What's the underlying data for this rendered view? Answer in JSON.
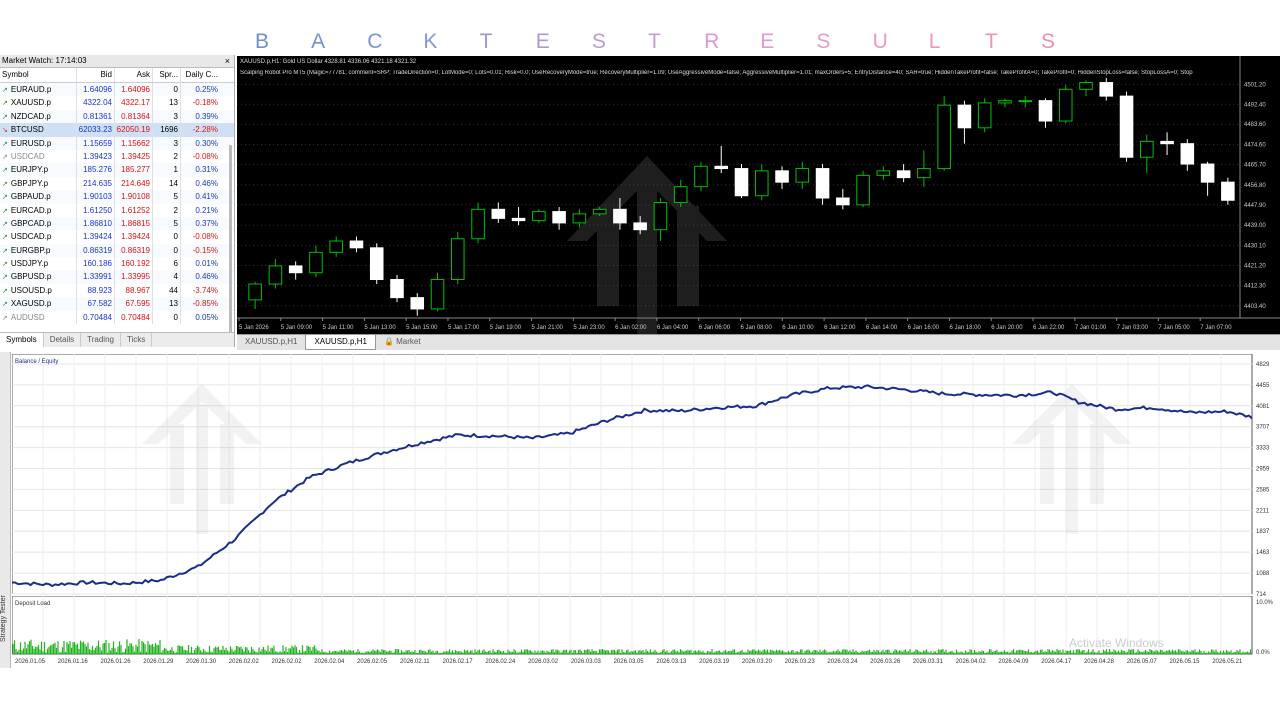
{
  "header": {
    "letters": [
      "B",
      "A",
      "C",
      "K",
      "T",
      "E",
      "S",
      "T",
      "R",
      "E",
      "S",
      "U",
      "L",
      "T",
      "S"
    ],
    "letter_colors": [
      "#6f8fd0",
      "#7491d1",
      "#7d93d2",
      "#8b96d4",
      "#9a98d5",
      "#ab9ad6",
      "#bb9ad6",
      "#cc9ad6",
      "#d99ad4",
      "#e29ad0",
      "#e79acb",
      "#ea98c4",
      "#ec96bd",
      "#ed93b5",
      "#ee90ad"
    ]
  },
  "market_watch": {
    "title": "Market Watch: 17:14:03",
    "close": "×",
    "columns": [
      "Symbol",
      "Bid",
      "Ask",
      "Spr...",
      "Daily C..."
    ],
    "rows": [
      {
        "symbol": "EURAUD.p",
        "bid": "1.64096",
        "ask": "1.64096",
        "spread": "0",
        "change": "0.25%",
        "dir": "up"
      },
      {
        "symbol": "XAUUSD.p",
        "bid": "4322.04",
        "ask": "4322.17",
        "spread": "13",
        "change": "-0.18%",
        "dir": "up"
      },
      {
        "symbol": "NZDCAD.p",
        "bid": "0.81361",
        "ask": "0.81364",
        "spread": "3",
        "change": "0.39%",
        "dir": "up"
      },
      {
        "symbol": "BTCUSD",
        "bid": "62033.23",
        "ask": "62050.19",
        "spread": "1696",
        "change": "-2.28%",
        "dir": "down"
      },
      {
        "symbol": "EURUSD.p",
        "bid": "1.15659",
        "ask": "1.15662",
        "spread": "3",
        "change": "0.30%",
        "dir": "up"
      },
      {
        "symbol": "USDCAD",
        "bid": "1.39423",
        "ask": "1.39425",
        "spread": "2",
        "change": "-0.08%",
        "dir": "flat"
      },
      {
        "symbol": "EURJPY.p",
        "bid": "185.276",
        "ask": "185.277",
        "spread": "1",
        "change": "0.31%",
        "dir": "up"
      },
      {
        "symbol": "GBPJPY.p",
        "bid": "214.635",
        "ask": "214.649",
        "spread": "14",
        "change": "0.46%",
        "dir": "up"
      },
      {
        "symbol": "GBPAUD.p",
        "bid": "1.90103",
        "ask": "1.90108",
        "spread": "5",
        "change": "0.41%",
        "dir": "up"
      },
      {
        "symbol": "EURCAD.p",
        "bid": "1.61250",
        "ask": "1.61252",
        "spread": "2",
        "change": "0.21%",
        "dir": "up"
      },
      {
        "symbol": "GBPCAD.p",
        "bid": "1.86810",
        "ask": "1.86815",
        "spread": "5",
        "change": "0.37%",
        "dir": "up"
      },
      {
        "symbol": "USDCAD.p",
        "bid": "1.39424",
        "ask": "1.39424",
        "spread": "0",
        "change": "-0.08%",
        "dir": "up"
      },
      {
        "symbol": "EURGBP.p",
        "bid": "0.86319",
        "ask": "0.86319",
        "spread": "0",
        "change": "-0.15%",
        "dir": "up"
      },
      {
        "symbol": "USDJPY.p",
        "bid": "160.186",
        "ask": "160.192",
        "spread": "6",
        "change": "0.01%",
        "dir": "up"
      },
      {
        "symbol": "GBPUSD.p",
        "bid": "1.33991",
        "ask": "1.33995",
        "spread": "4",
        "change": "0.46%",
        "dir": "up"
      },
      {
        "symbol": "USOUSD.p",
        "bid": "88.923",
        "ask": "88.967",
        "spread": "44",
        "change": "-3.74%",
        "dir": "up"
      },
      {
        "symbol": "XAGUSD.p",
        "bid": "67.582",
        "ask": "67.595",
        "spread": "13",
        "change": "-0.85%",
        "dir": "up"
      },
      {
        "symbol": "AUDUSD",
        "bid": "0.70484",
        "ask": "0.70484",
        "spread": "0",
        "change": "0.05%",
        "dir": "flat"
      }
    ],
    "tabs": [
      "Symbols",
      "Details",
      "Trading",
      "Ticks"
    ]
  },
  "price_chart": {
    "symbol_line": "XAUUSD.p,H1:  Gold US Dollar  4328.81 4336.06 4321.18 4321.32",
    "ea_line": "Scalping Robot Pro MT5 (Magic=77781; comment=SRP; TradeDirection=0; LotMode=0; Lots=0.01; Risk=0.0; UseRecoveryMode=true; RecoveryMultiplier=1.09; UseAggressiveMode=false; AggressiveMultiplier=1.01; maxOrders=5; EntryDistance=40; SAR=true; HiddenTakeProfit=false; TakeProfitA=0; TakeProfit=0; HiddenStopLoss=false; StopLossA=0; Stop",
    "y_ticks": [
      "4501.20",
      "4492.40",
      "4483.60",
      "4474.60",
      "4465.70",
      "4456.80",
      "4447.90",
      "4439.00",
      "4430.10",
      "4421.20",
      "4412.30",
      "4403.40"
    ],
    "x_ticks": [
      "5 Jan 2026",
      "5 Jan 09:00",
      "5 Jan 11:00",
      "5 Jan 13:00",
      "5 Jan 15:00",
      "5 Jan 17:00",
      "5 Jan 19:00",
      "5 Jan 21:00",
      "5 Jan 23:00",
      "6 Jan 02:00",
      "6 Jan 04:00",
      "6 Jan 06:00",
      "6 Jan 08:00",
      "6 Jan 10:00",
      "6 Jan 12:00",
      "6 Jan 14:00",
      "6 Jan 16:00",
      "6 Jan 18:00",
      "6 Jan 20:00",
      "6 Jan 22:00",
      "7 Jan 01:00",
      "7 Jan 03:00",
      "7 Jan 05:00",
      "7 Jan 07:00"
    ],
    "tabs": [
      "XAUUSD.p,H1",
      "XAUUSD.p,H1",
      "Market"
    ],
    "ylim": [
      4398,
      4504
    ],
    "candles": [
      [
        4406,
        4413,
        4402,
        4414
      ],
      [
        4413,
        4421,
        4411,
        4424
      ],
      [
        4421,
        4418,
        4415,
        4423
      ],
      [
        4418,
        4427,
        4416,
        4430
      ],
      [
        4427,
        4432,
        4425,
        4434
      ],
      [
        4432,
        4429,
        4427,
        4434
      ],
      [
        4429,
        4415,
        4413,
        4431
      ],
      [
        4415,
        4407,
        4405,
        4417
      ],
      [
        4407,
        4402,
        4399,
        4409
      ],
      [
        4402,
        4415,
        4401,
        4418
      ],
      [
        4415,
        4433,
        4413,
        4436
      ],
      [
        4433,
        4446,
        4431,
        4449
      ],
      [
        4446,
        4442,
        4440,
        4449
      ],
      [
        4442,
        4441,
        4439,
        4447
      ],
      [
        4441,
        4445,
        4440,
        4446
      ],
      [
        4445,
        4440,
        4437,
        4447
      ],
      [
        4440,
        4444,
        4438,
        4446
      ],
      [
        4444,
        4446,
        4443,
        4447
      ],
      [
        4446,
        4440,
        4437,
        4451
      ],
      [
        4440,
        4437,
        4435,
        4443
      ],
      [
        4437,
        4449,
        4432,
        4451
      ],
      [
        4449,
        4456,
        4447,
        4459
      ],
      [
        4456,
        4465,
        4454,
        4467
      ],
      [
        4465,
        4464,
        4462,
        4474
      ],
      [
        4464,
        4452,
        4451,
        4466
      ],
      [
        4452,
        4463,
        4450,
        4466
      ],
      [
        4463,
        4458,
        4455,
        4465
      ],
      [
        4458,
        4464,
        4455,
        4467
      ],
      [
        4464,
        4451,
        4448,
        4466
      ],
      [
        4451,
        4448,
        4446,
        4455
      ],
      [
        4448,
        4461,
        4447,
        4463
      ],
      [
        4461,
        4463,
        4459,
        4465
      ],
      [
        4463,
        4460,
        4458,
        4466
      ],
      [
        4460,
        4464,
        4456,
        4472
      ],
      [
        4464,
        4492,
        4463,
        4496
      ],
      [
        4492,
        4482,
        4475,
        4494
      ],
      [
        4482,
        4493,
        4480,
        4495
      ],
      [
        4493,
        4494,
        4491,
        4495
      ],
      [
        4494,
        4494,
        4491,
        4496
      ],
      [
        4494,
        4485,
        4482,
        4495
      ],
      [
        4485,
        4499,
        4484,
        4501
      ],
      [
        4499,
        4502,
        4496,
        4503
      ],
      [
        4502,
        4496,
        4494,
        4504
      ],
      [
        4496,
        4469,
        4467,
        4498
      ],
      [
        4469,
        4476,
        4462,
        4479
      ],
      [
        4476,
        4475,
        4470,
        4480
      ],
      [
        4475,
        4466,
        4463,
        4477
      ],
      [
        4466,
        4458,
        4452,
        4467
      ],
      [
        4458,
        4450,
        4448,
        4460
      ]
    ]
  },
  "tester": {
    "side_label": "Strategy Tester",
    "balance_legend": "Balance / Equity",
    "balance_y_ticks": [
      "4829",
      "4455",
      "4081",
      "3707",
      "3333",
      "2959",
      "2585",
      "2211",
      "1837",
      "1463",
      "1088",
      "714"
    ],
    "deposit_label": "Deposit Load",
    "deposit_y_ticks": [
      "10.0%",
      "0.0%"
    ],
    "x_ticks": [
      "2026.01.05",
      "2026.01.16",
      "2026.01.26",
      "2026.01.29",
      "2026.01.30",
      "2026.02.02",
      "2026.02.02",
      "2026.02.04",
      "2026.02.05",
      "2026.02.11",
      "2026.02.17",
      "2026.02.24",
      "2026.03.02",
      "2026.03.03",
      "2026.03.05",
      "2026.03.13",
      "2026.03.19",
      "2026.03.20",
      "2026.03.23",
      "2026.03.24",
      "2026.03.26",
      "2026.03.31",
      "2026.04.02",
      "2026.04.09",
      "2026.04.17",
      "2026.04.28",
      "2026.05.07",
      "2026.05.15",
      "2026.05.21"
    ],
    "balance_ylim": [
      714,
      4829
    ],
    "balance_points": [
      [
        0,
        920
      ],
      [
        0.03,
        880
      ],
      [
        0.06,
        920
      ],
      [
        0.09,
        900
      ],
      [
        0.12,
        960
      ],
      [
        0.15,
        1200
      ],
      [
        0.18,
        1700
      ],
      [
        0.21,
        2350
      ],
      [
        0.24,
        2800
      ],
      [
        0.27,
        3050
      ],
      [
        0.3,
        3250
      ],
      [
        0.33,
        3420
      ],
      [
        0.36,
        3560
      ],
      [
        0.39,
        3540
      ],
      [
        0.42,
        3500
      ],
      [
        0.45,
        3590
      ],
      [
        0.48,
        3820
      ],
      [
        0.51,
        4000
      ],
      [
        0.54,
        3990
      ],
      [
        0.57,
        4050
      ],
      [
        0.6,
        4080
      ],
      [
        0.63,
        4280
      ],
      [
        0.66,
        4400
      ],
      [
        0.69,
        4420
      ],
      [
        0.72,
        4370
      ],
      [
        0.75,
        4300
      ],
      [
        0.78,
        4280
      ],
      [
        0.81,
        4270
      ],
      [
        0.84,
        4320
      ],
      [
        0.86,
        4150
      ],
      [
        0.89,
        4020
      ],
      [
        0.92,
        4050
      ],
      [
        0.95,
        3960
      ],
      [
        0.98,
        3980
      ],
      [
        1.0,
        3880
      ]
    ]
  },
  "overlay": {
    "activate_windows": "Activate Windows"
  }
}
